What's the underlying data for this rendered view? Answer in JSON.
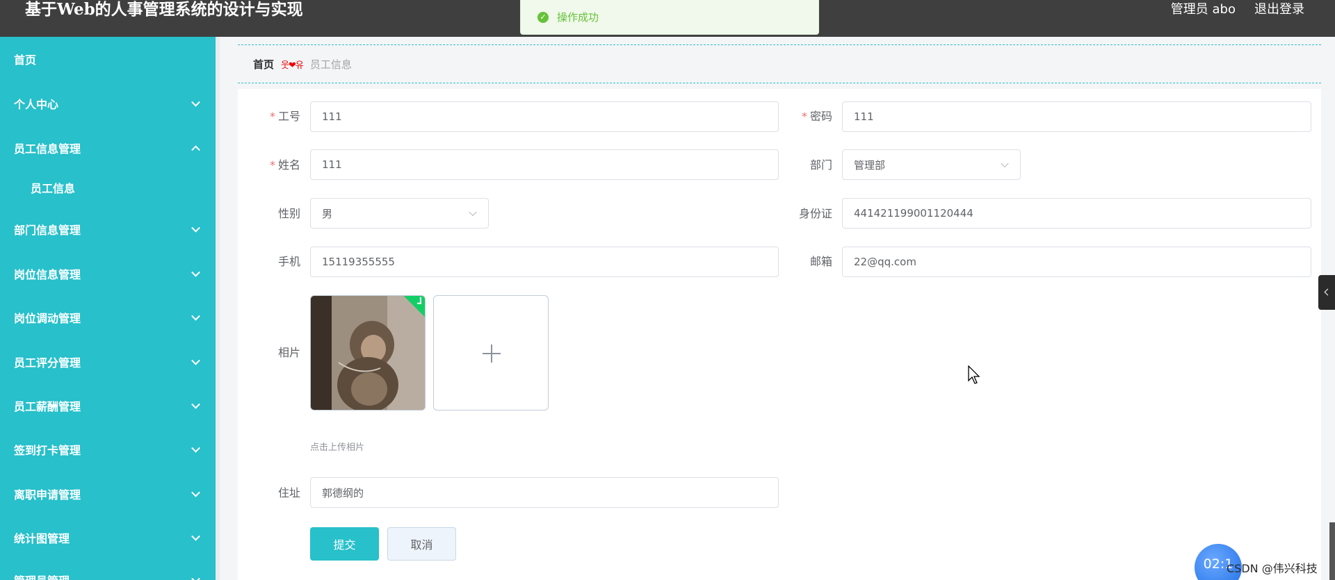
{
  "header": {
    "title": "基于Web的人事管理系统的设计与实现",
    "user": "管理员 abo",
    "logout": "退出登录"
  },
  "toast": {
    "text": "操作成功",
    "type": "success",
    "color": "#67c23a"
  },
  "sidebar": {
    "bg_color": "#27c0cb",
    "items": [
      {
        "label": "首页"
      },
      {
        "label": "个人中心"
      },
      {
        "label": "员工信息管理"
      },
      {
        "label": "员工信息"
      },
      {
        "label": "部门信息管理"
      },
      {
        "label": "岗位信息管理"
      },
      {
        "label": "岗位调动管理"
      },
      {
        "label": "员工评分管理"
      },
      {
        "label": "员工薪酬管理"
      },
      {
        "label": "签到打卡管理"
      },
      {
        "label": "离职申请管理"
      },
      {
        "label": "统计图管理"
      },
      {
        "label": "管理员管理"
      }
    ]
  },
  "breadcrumb": {
    "home": "首页",
    "separator": "웃❤유",
    "current": "员工信息"
  },
  "form": {
    "job_no": {
      "label": "工号",
      "value": "111",
      "required": true
    },
    "password": {
      "label": "密码",
      "value": "111",
      "required": true
    },
    "name": {
      "label": "姓名",
      "value": "111",
      "required": true
    },
    "dept": {
      "label": "部门",
      "value": "管理部"
    },
    "gender": {
      "label": "性别",
      "value": "男"
    },
    "id_card": {
      "label": "身份证",
      "value": "441421199001120444"
    },
    "phone": {
      "label": "手机",
      "value": "15119355555"
    },
    "email": {
      "label": "邮箱",
      "value": "22@qq.com"
    },
    "photo": {
      "label": "相片",
      "tip": "点击上传相片"
    },
    "address": {
      "label": "住址",
      "value": "郭德纲的"
    },
    "required_mark": "*",
    "submit": "提交",
    "cancel": "取消"
  },
  "overlay": {
    "timer": "02:1",
    "watermark": "CSDN @伟兴科技"
  }
}
